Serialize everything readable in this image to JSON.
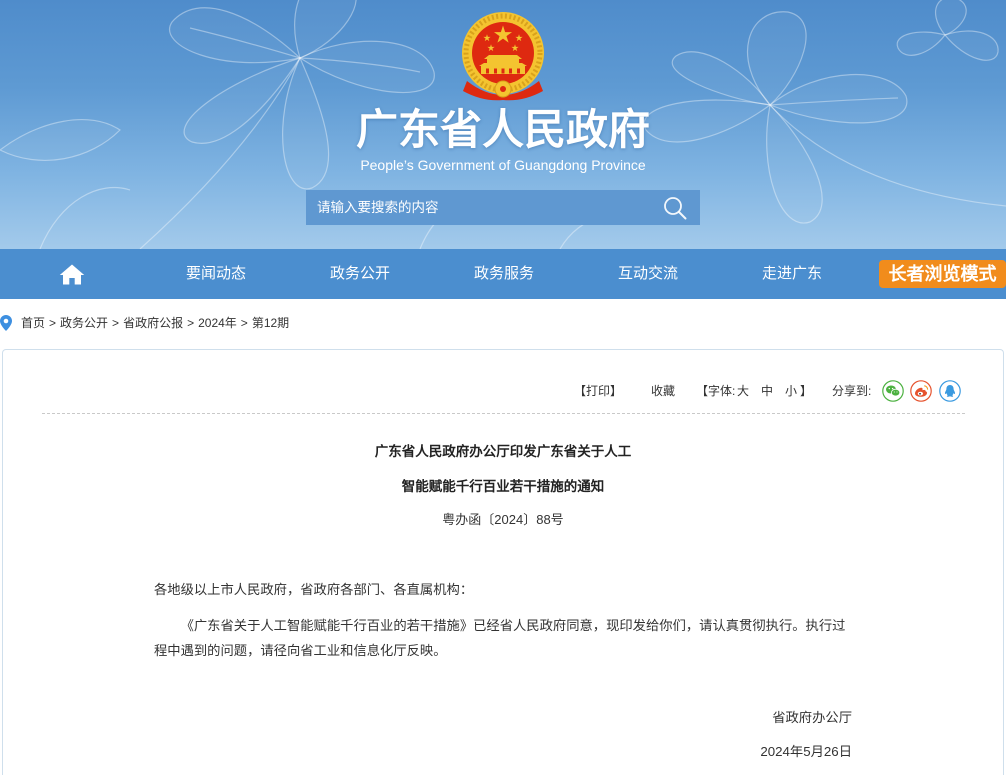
{
  "header": {
    "title": "广东省人民政府",
    "subtitle": "People’s Government of Guangdong Province",
    "search": {
      "placeholder": "请输入要搜索的内容"
    }
  },
  "nav": {
    "items": [
      "要闻动态",
      "政务公开",
      "政务服务",
      "互动交流",
      "走进广东"
    ],
    "elder_mode": "长者浏览模式"
  },
  "breadcrumb": {
    "items": [
      "首页",
      "政务公开",
      "省政府公报",
      "2024年",
      "第12期"
    ],
    "separator": ">"
  },
  "toolbar": {
    "print": "【打印】",
    "favorite": "收藏",
    "font_label": "【字体:",
    "font_large": "大",
    "font_medium": "中",
    "font_small": "小",
    "font_bracket_close": "】",
    "share_label": "分享到:"
  },
  "article": {
    "title_lines": [
      "广东省人民政府办公厅印发广东省关于人工",
      "智能赋能千行百业若干措施的通知"
    ],
    "document_number": "粤办函〔2024〕88号",
    "salutation": "各地级以上市人民政府，省政府各部门、各直属机构：",
    "body": "《广东省关于人工智能赋能千行百业的若干措施》已经省人民政府同意，现印发给你们，请认真贯彻执行。执行过程中遇到的问题，请径向省工业和信息化厅反映。",
    "issuer": "省政府办公厅",
    "date": "2024年5月26日"
  },
  "icons": {
    "emblem": "national-emblem-icon",
    "search": "search-icon",
    "home": "home-icon",
    "location": "location-pin-icon",
    "share": [
      "wechat-icon",
      "weibo-icon",
      "qq-icon"
    ]
  },
  "colors": {
    "nav-blue": "#4b8ecf",
    "elder-orange": "#f18c1c",
    "wechat-green": "#4cb140",
    "weibo-red": "#e6532e",
    "qq-blue": "#3a9ae0",
    "pin-blue": "#3d8fe0"
  }
}
